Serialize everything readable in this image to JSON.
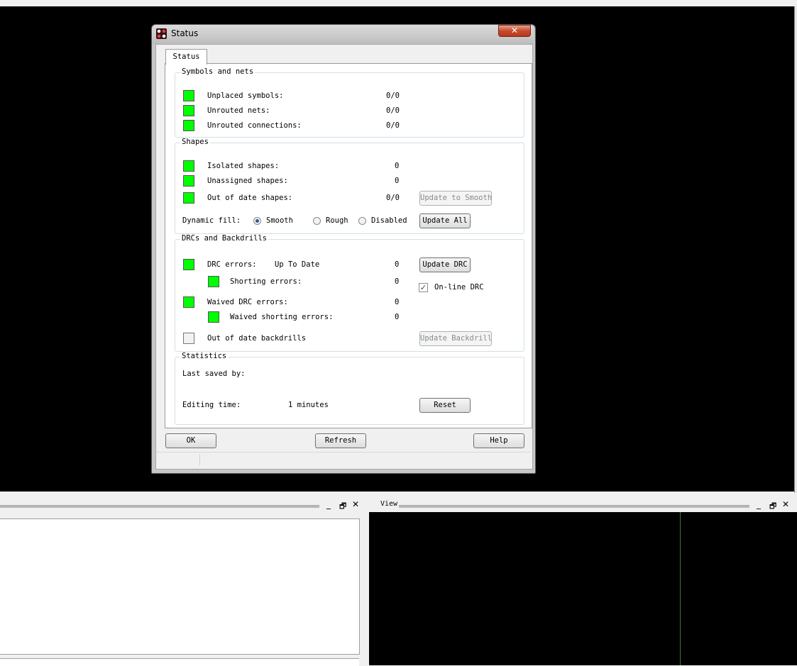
{
  "dialog": {
    "title": "Status",
    "close_glyph": "✕",
    "tab_label": "Status",
    "symbols_nets": {
      "title": "Symbols and nets",
      "rows": [
        {
          "label": "Unplaced symbols:",
          "value": "0/0"
        },
        {
          "label": "Unrouted nets:",
          "value": "0/0"
        },
        {
          "label": "Unrouted connections:",
          "value": "0/0"
        }
      ]
    },
    "shapes": {
      "title": "Shapes",
      "rows": [
        {
          "label": "Isolated shapes:",
          "value": "0"
        },
        {
          "label": "Unassigned shapes:",
          "value": "0"
        },
        {
          "label": "Out of date shapes:",
          "value": "0/0"
        }
      ],
      "update_to_smooth": "Update to Smooth",
      "dynamic_fill_label": "Dynamic fill:",
      "fill_options": [
        "Smooth",
        "Rough",
        "Disabled"
      ],
      "fill_selected": "Smooth",
      "update_all": "Update All"
    },
    "drc": {
      "title": "DRCs and Backdrills",
      "drc_errors_label": "DRC errors:",
      "drc_status": "Up To Date",
      "drc_errors_value": "0",
      "update_drc": "Update DRC",
      "shorting_label": "Shorting errors:",
      "shorting_value": "0",
      "online_drc_label": "On-line DRC",
      "online_drc_checked": true,
      "waived_label": "Waived DRC errors:",
      "waived_value": "0",
      "waived_shorting_label": "Waived shorting errors:",
      "waived_shorting_value": "0",
      "backdrills_label": "Out of date backdrills",
      "update_backdrill": "Update Backdrill"
    },
    "statistics": {
      "title": "Statistics",
      "last_saved_label": "Last saved by:",
      "editing_time_label": "Editing time:",
      "editing_time_value": "1 minutes",
      "reset": "Reset"
    },
    "buttons": {
      "ok": "OK",
      "refresh": "Refresh",
      "help": "Help"
    }
  },
  "panes": {
    "view_title": "View",
    "minimize_glyph": "_",
    "restore_glyph": "🗗",
    "close_glyph": "✕"
  },
  "colors": {
    "ok_indicator": "#00ff00",
    "canvas": "#000000"
  }
}
